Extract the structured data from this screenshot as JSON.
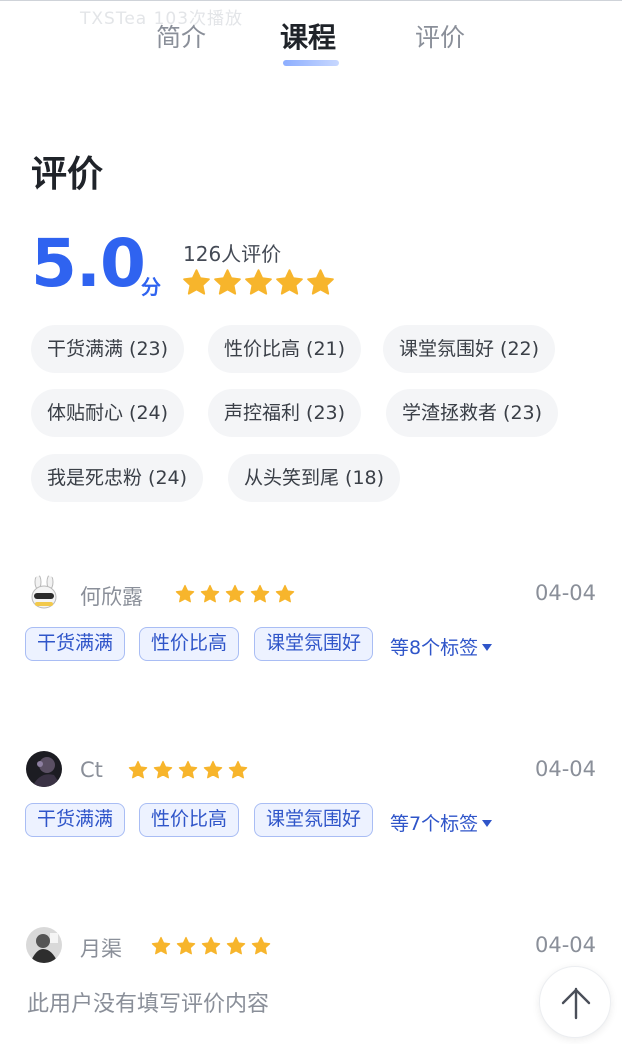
{
  "header": {
    "ghost_text": "TXSTea    103次播放",
    "tabs": [
      {
        "label": "简介",
        "active": false
      },
      {
        "label": "课程",
        "active": true
      },
      {
        "label": "评价",
        "active": false
      }
    ]
  },
  "reviews_section": {
    "title": "评价",
    "score": "5.0",
    "score_unit": "分",
    "rating_count_text": "126人评价",
    "rating_stars": 5,
    "tags": [
      {
        "label": "干货满满 (23)"
      },
      {
        "label": "性价比高 (21)"
      },
      {
        "label": "课堂氛围好 (22)"
      },
      {
        "label": "体贴耐心 (24)"
      },
      {
        "label": "声控福利 (23)"
      },
      {
        "label": "学渣拯救者 (23)"
      },
      {
        "label": "我是死忠粉 (24)"
      },
      {
        "label": "从头笑到尾 (18)"
      }
    ]
  },
  "reviews": [
    {
      "name": "何欣露",
      "stars": 5,
      "date": "04-04",
      "tags": [
        "干货满满",
        "性价比高",
        "课堂氛围好"
      ],
      "more_tags": "等8个标签"
    },
    {
      "name": "Ct",
      "stars": 5,
      "date": "04-04",
      "tags": [
        "干货满满",
        "性价比高",
        "课堂氛围好"
      ],
      "more_tags": "等7个标签"
    },
    {
      "name": "月渠",
      "stars": 5,
      "date": "04-04",
      "content": "此用户没有填写评价内容"
    }
  ],
  "colors": {
    "accent": "#2f63f0",
    "star": "#f7b52c",
    "tag_bg": "#edf2ff",
    "chip_bg": "#f4f5f7"
  },
  "icons": {
    "star": "star-icon",
    "back_to_top": "arrow-up-icon",
    "dropdown": "caret-down-icon"
  }
}
